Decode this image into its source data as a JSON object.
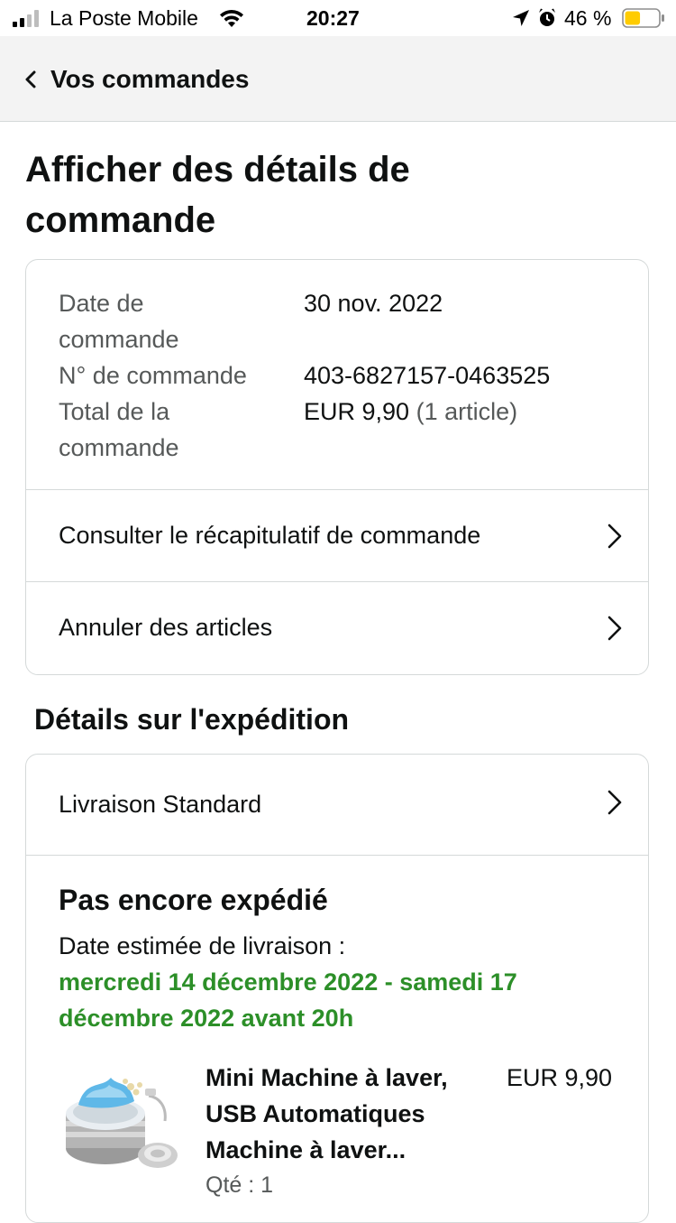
{
  "status_bar": {
    "carrier": "La Poste Mobile",
    "time": "20:27",
    "battery_percent": "46 %",
    "battery_level": 0.46,
    "battery_color": "#ffcc00",
    "icons": [
      "signal-icon",
      "wifi-icon",
      "location-arrow-icon",
      "alarm-icon",
      "battery-icon"
    ]
  },
  "nav": {
    "back_label": "Vos commandes",
    "back_icon": "chevron-left-icon"
  },
  "page": {
    "title_line1": "Afficher des détails de",
    "title_line2": "commande"
  },
  "order_summary": {
    "date_label_line1": "Date de",
    "date_label_line2": "commande",
    "date_value": "30 nov. 2022",
    "number_label": "N° de commande",
    "number_value": "403-6827157-0463525",
    "total_label_line1": "Total de la",
    "total_label_line2": "commande",
    "total_value": "EUR 9,90",
    "total_items": "(1 article)"
  },
  "order_links": [
    {
      "label": "Consulter le récapitulatif de commande"
    },
    {
      "label": "Annuler des articles"
    }
  ],
  "shipping": {
    "section_title": "Détails sur l'expédition",
    "method": "Livraison Standard",
    "status": "Pas encore expédié",
    "estimated_label": "Date estimée de livraison :",
    "estimated_date_line1": "mercredi 14 décembre 2022 - samedi 17",
    "estimated_date_line2": "décembre 2022 avant 20h",
    "estimated_date_color": "#2c8f28"
  },
  "product": {
    "title_line1": "Mini Machine à laver,",
    "title_line2": "USB Automatiques",
    "title_line3": "Machine à laver...",
    "price": "EUR 9,90",
    "quantity": "Qté : 1"
  }
}
